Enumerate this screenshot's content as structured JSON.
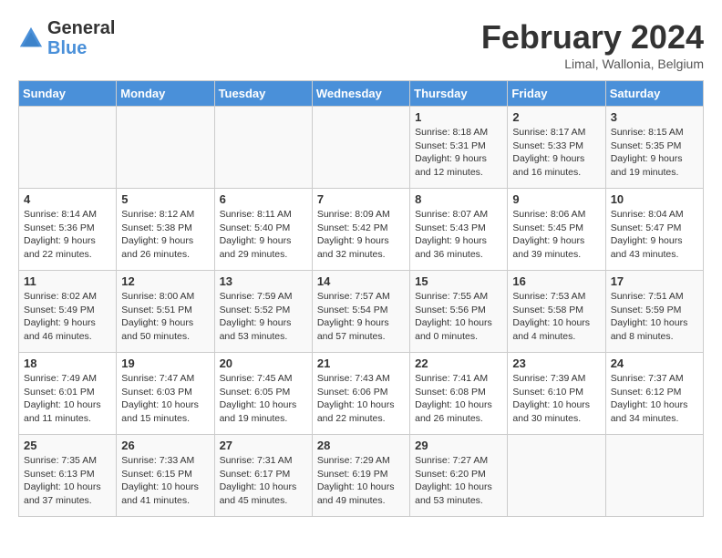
{
  "logo": {
    "general": "General",
    "blue": "Blue"
  },
  "title": {
    "month_year": "February 2024",
    "location": "Limal, Wallonia, Belgium"
  },
  "days_of_week": [
    "Sunday",
    "Monday",
    "Tuesday",
    "Wednesday",
    "Thursday",
    "Friday",
    "Saturday"
  ],
  "weeks": [
    [
      {
        "day": "",
        "info": ""
      },
      {
        "day": "",
        "info": ""
      },
      {
        "day": "",
        "info": ""
      },
      {
        "day": "",
        "info": ""
      },
      {
        "day": "1",
        "info": "Sunrise: 8:18 AM\nSunset: 5:31 PM\nDaylight: 9 hours\nand 12 minutes."
      },
      {
        "day": "2",
        "info": "Sunrise: 8:17 AM\nSunset: 5:33 PM\nDaylight: 9 hours\nand 16 minutes."
      },
      {
        "day": "3",
        "info": "Sunrise: 8:15 AM\nSunset: 5:35 PM\nDaylight: 9 hours\nand 19 minutes."
      }
    ],
    [
      {
        "day": "4",
        "info": "Sunrise: 8:14 AM\nSunset: 5:36 PM\nDaylight: 9 hours\nand 22 minutes."
      },
      {
        "day": "5",
        "info": "Sunrise: 8:12 AM\nSunset: 5:38 PM\nDaylight: 9 hours\nand 26 minutes."
      },
      {
        "day": "6",
        "info": "Sunrise: 8:11 AM\nSunset: 5:40 PM\nDaylight: 9 hours\nand 29 minutes."
      },
      {
        "day": "7",
        "info": "Sunrise: 8:09 AM\nSunset: 5:42 PM\nDaylight: 9 hours\nand 32 minutes."
      },
      {
        "day": "8",
        "info": "Sunrise: 8:07 AM\nSunset: 5:43 PM\nDaylight: 9 hours\nand 36 minutes."
      },
      {
        "day": "9",
        "info": "Sunrise: 8:06 AM\nSunset: 5:45 PM\nDaylight: 9 hours\nand 39 minutes."
      },
      {
        "day": "10",
        "info": "Sunrise: 8:04 AM\nSunset: 5:47 PM\nDaylight: 9 hours\nand 43 minutes."
      }
    ],
    [
      {
        "day": "11",
        "info": "Sunrise: 8:02 AM\nSunset: 5:49 PM\nDaylight: 9 hours\nand 46 minutes."
      },
      {
        "day": "12",
        "info": "Sunrise: 8:00 AM\nSunset: 5:51 PM\nDaylight: 9 hours\nand 50 minutes."
      },
      {
        "day": "13",
        "info": "Sunrise: 7:59 AM\nSunset: 5:52 PM\nDaylight: 9 hours\nand 53 minutes."
      },
      {
        "day": "14",
        "info": "Sunrise: 7:57 AM\nSunset: 5:54 PM\nDaylight: 9 hours\nand 57 minutes."
      },
      {
        "day": "15",
        "info": "Sunrise: 7:55 AM\nSunset: 5:56 PM\nDaylight: 10 hours\nand 0 minutes."
      },
      {
        "day": "16",
        "info": "Sunrise: 7:53 AM\nSunset: 5:58 PM\nDaylight: 10 hours\nand 4 minutes."
      },
      {
        "day": "17",
        "info": "Sunrise: 7:51 AM\nSunset: 5:59 PM\nDaylight: 10 hours\nand 8 minutes."
      }
    ],
    [
      {
        "day": "18",
        "info": "Sunrise: 7:49 AM\nSunset: 6:01 PM\nDaylight: 10 hours\nand 11 minutes."
      },
      {
        "day": "19",
        "info": "Sunrise: 7:47 AM\nSunset: 6:03 PM\nDaylight: 10 hours\nand 15 minutes."
      },
      {
        "day": "20",
        "info": "Sunrise: 7:45 AM\nSunset: 6:05 PM\nDaylight: 10 hours\nand 19 minutes."
      },
      {
        "day": "21",
        "info": "Sunrise: 7:43 AM\nSunset: 6:06 PM\nDaylight: 10 hours\nand 22 minutes."
      },
      {
        "day": "22",
        "info": "Sunrise: 7:41 AM\nSunset: 6:08 PM\nDaylight: 10 hours\nand 26 minutes."
      },
      {
        "day": "23",
        "info": "Sunrise: 7:39 AM\nSunset: 6:10 PM\nDaylight: 10 hours\nand 30 minutes."
      },
      {
        "day": "24",
        "info": "Sunrise: 7:37 AM\nSunset: 6:12 PM\nDaylight: 10 hours\nand 34 minutes."
      }
    ],
    [
      {
        "day": "25",
        "info": "Sunrise: 7:35 AM\nSunset: 6:13 PM\nDaylight: 10 hours\nand 37 minutes."
      },
      {
        "day": "26",
        "info": "Sunrise: 7:33 AM\nSunset: 6:15 PM\nDaylight: 10 hours\nand 41 minutes."
      },
      {
        "day": "27",
        "info": "Sunrise: 7:31 AM\nSunset: 6:17 PM\nDaylight: 10 hours\nand 45 minutes."
      },
      {
        "day": "28",
        "info": "Sunrise: 7:29 AM\nSunset: 6:19 PM\nDaylight: 10 hours\nand 49 minutes."
      },
      {
        "day": "29",
        "info": "Sunrise: 7:27 AM\nSunset: 6:20 PM\nDaylight: 10 hours\nand 53 minutes."
      },
      {
        "day": "",
        "info": ""
      },
      {
        "day": "",
        "info": ""
      }
    ]
  ]
}
